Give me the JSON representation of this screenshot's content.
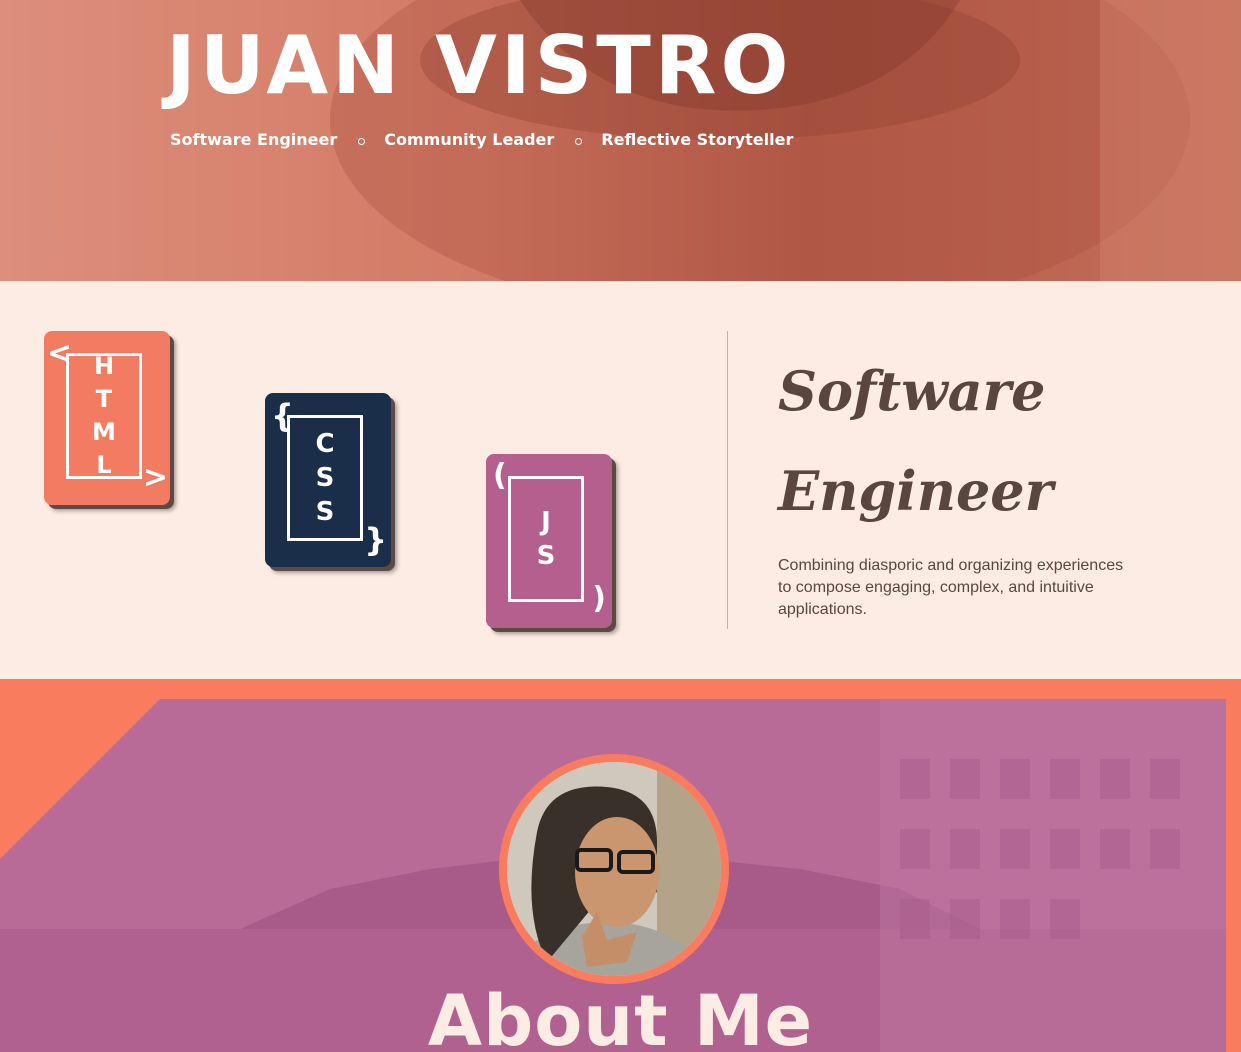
{
  "hero": {
    "name": "JUAN VISTRO",
    "roles": [
      "Software Engineer",
      "Community Leader",
      "Reflective Storyteller"
    ]
  },
  "skills": {
    "cards": [
      {
        "letters": "H\nT\nM\nL",
        "open": "<",
        "close": ">",
        "color": "#f37b61"
      },
      {
        "letters": "C\nS\nS",
        "open": "{",
        "close": "}",
        "color": "#1a2e4a"
      },
      {
        "letters": "J\nS",
        "open": "(",
        "close": ")",
        "color": "#b55f8f"
      }
    ],
    "heading": "Software Engineer",
    "description": "Combining diasporic and organizing experiences to compose engaging, complex, and intuitive applications."
  },
  "about": {
    "title": "About Me"
  },
  "colors": {
    "hero": "#d27a64",
    "cream": "#fdece3",
    "coral": "#fa7c5f",
    "purple": "#b96b98",
    "navy": "#1a2e4a",
    "text": "#5a463e"
  }
}
